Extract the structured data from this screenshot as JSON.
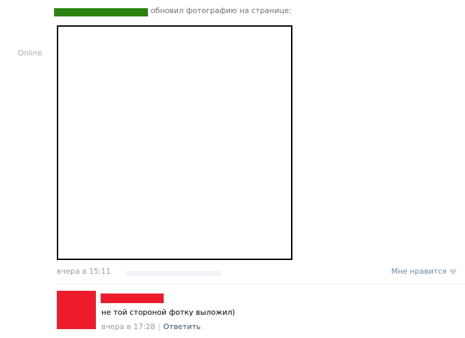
{
  "post": {
    "action_text": "обновил фотографию на странице:",
    "online_status": "Online",
    "date": "вчера в 15:11",
    "like_label": "Мне нравится",
    "like_icon": "heart-icon"
  },
  "comment": {
    "text": "не той стороной фотку выложил)",
    "date": "вчера в 17:28",
    "separator": "|",
    "reply_label": "Ответить"
  },
  "colors": {
    "author_redaction": "#2b820f",
    "commenter_redaction": "#ee1b2d",
    "link": "#2b587a",
    "meta_text": "#9a9a9a"
  }
}
